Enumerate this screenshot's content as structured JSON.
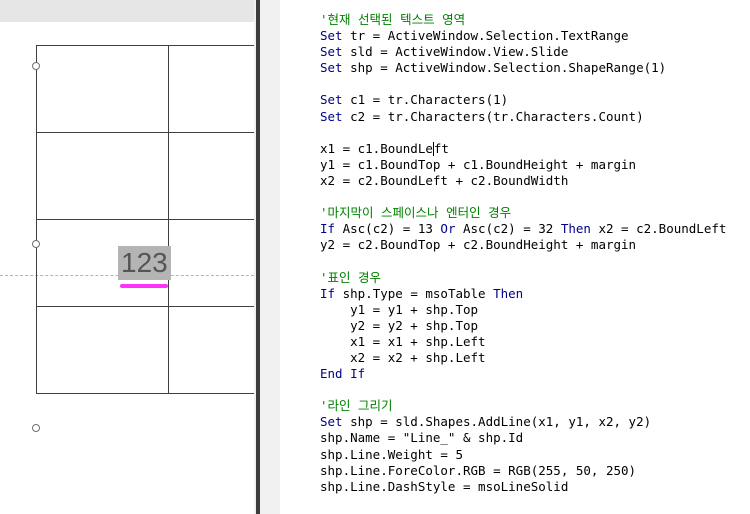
{
  "slide": {
    "cell_text": "123",
    "underline_color": "#ff32fa"
  },
  "code": {
    "lines": [
      [
        {
          "t": "'현재 선택된 텍스트 영역",
          "c": "cm"
        }
      ],
      [
        {
          "t": "Set",
          "c": "kw"
        },
        {
          "t": " tr = ActiveWindow.Selection.TextRange"
        }
      ],
      [
        {
          "t": "Set",
          "c": "kw"
        },
        {
          "t": " sld = ActiveWindow.View.Slide"
        }
      ],
      [
        {
          "t": "Set",
          "c": "kw"
        },
        {
          "t": " shp = ActiveWindow.Selection.ShapeRange(1)"
        }
      ],
      [],
      [
        {
          "t": "Set",
          "c": "kw"
        },
        {
          "t": " c1 = tr.Characters(1)"
        }
      ],
      [
        {
          "t": "Set",
          "c": "kw"
        },
        {
          "t": " c2 = tr.Characters(tr.Characters.Count)"
        }
      ],
      [],
      [
        {
          "t": "x1 = c1.BoundLe"
        },
        {
          "t": "",
          "c": "caret"
        },
        {
          "t": "ft"
        }
      ],
      [
        {
          "t": "y1 = c1.BoundTop + c1.BoundHeight + margin"
        }
      ],
      [
        {
          "t": "x2 = c2.BoundLeft + c2.BoundWidth"
        }
      ],
      [],
      [
        {
          "t": "'마지막이 스페이스나 엔터인 경우",
          "c": "cm"
        }
      ],
      [
        {
          "t": "If",
          "c": "kw"
        },
        {
          "t": " Asc(c2) = 13 "
        },
        {
          "t": "Or",
          "c": "kw"
        },
        {
          "t": " Asc(c2) = 32 "
        },
        {
          "t": "Then",
          "c": "kw"
        },
        {
          "t": " x2 = c2.BoundLeft"
        }
      ],
      [
        {
          "t": "y2 = c2.BoundTop + c2.BoundHeight + margin"
        }
      ],
      [],
      [
        {
          "t": "'표인 경우",
          "c": "cm"
        }
      ],
      [
        {
          "t": "If",
          "c": "kw"
        },
        {
          "t": " shp.Type = msoTable "
        },
        {
          "t": "Then",
          "c": "kw"
        }
      ],
      [
        {
          "t": "    y1 = y1 + shp.Top"
        }
      ],
      [
        {
          "t": "    y2 = y2 + shp.Top"
        }
      ],
      [
        {
          "t": "    x1 = x1 + shp.Left"
        }
      ],
      [
        {
          "t": "    x2 = x2 + shp.Left"
        }
      ],
      [
        {
          "t": "End If",
          "c": "kw"
        }
      ],
      [],
      [
        {
          "t": "'라인 그리기",
          "c": "cm"
        }
      ],
      [
        {
          "t": "Set",
          "c": "kw"
        },
        {
          "t": " shp = sld.Shapes.AddLine(x1, y1, x2, y2)"
        }
      ],
      [
        {
          "t": "shp.Name = \"Line_\" & shp.Id"
        }
      ],
      [
        {
          "t": "shp.Line.Weight = 5"
        }
      ],
      [
        {
          "t": "shp.Line.ForeColor.RGB = RGB(255, 50, 250)"
        }
      ],
      [
        {
          "t": "shp.Line.DashStyle = msoLineSolid"
        }
      ]
    ]
  }
}
